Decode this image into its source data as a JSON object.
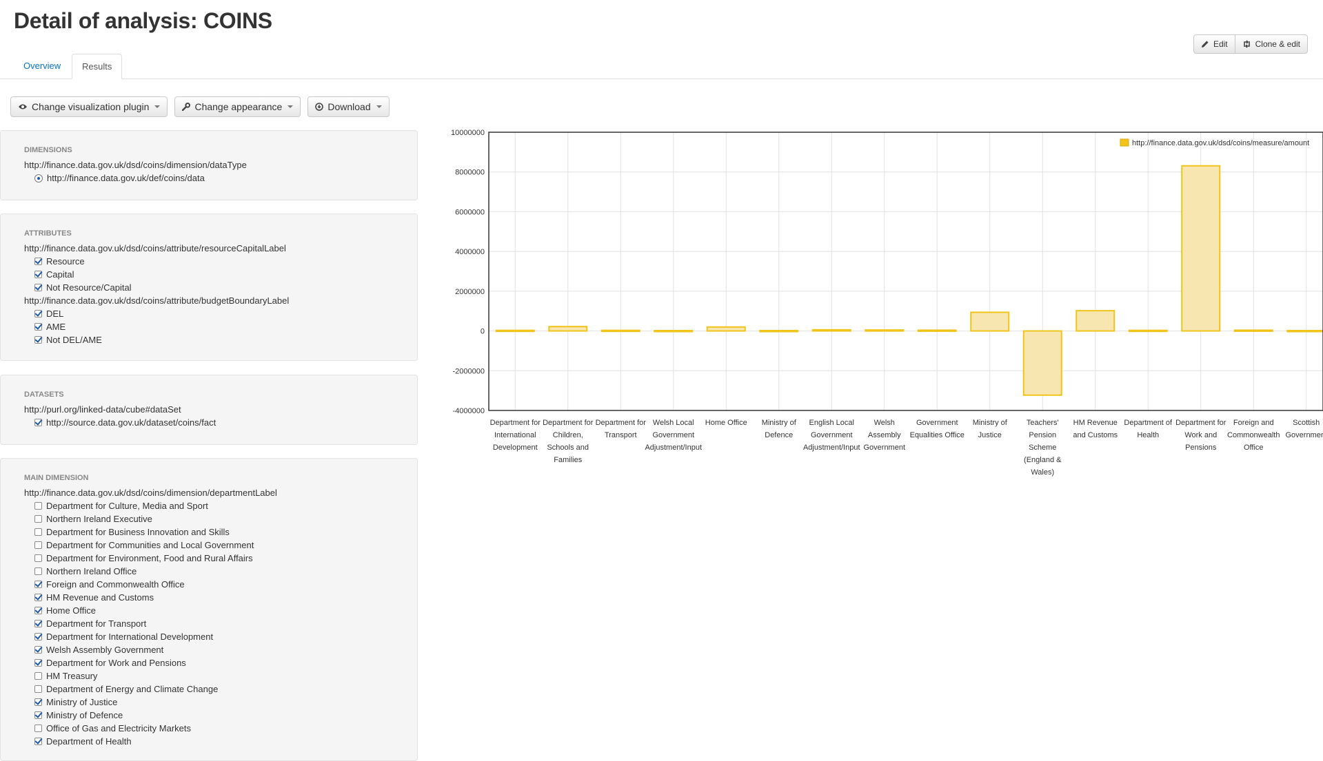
{
  "page": {
    "title": "Detail of analysis: COINS"
  },
  "actions": {
    "edit": "Edit",
    "clone": "Clone & edit"
  },
  "tabs": {
    "overview": "Overview",
    "results": "Results"
  },
  "toolbar": {
    "change_plugin": "Change visualization plugin",
    "change_appearance": "Change appearance",
    "download": "Download"
  },
  "dimensions": {
    "heading": "DIMENSIONS",
    "property": "http://finance.data.gov.uk/dsd/coins/dimension/dataType",
    "options": [
      {
        "label": "http://finance.data.gov.uk/def/coins/data",
        "selected": true
      }
    ]
  },
  "attributes": {
    "heading": "ATTRIBUTES",
    "groups": [
      {
        "property": "http://finance.data.gov.uk/dsd/coins/attribute/resourceCapitalLabel",
        "options": [
          {
            "label": "Resource",
            "checked": true
          },
          {
            "label": "Capital",
            "checked": true
          },
          {
            "label": "Not Resource/Capital",
            "checked": true
          }
        ]
      },
      {
        "property": "http://finance.data.gov.uk/dsd/coins/attribute/budgetBoundaryLabel",
        "options": [
          {
            "label": "DEL",
            "checked": true
          },
          {
            "label": "AME",
            "checked": true
          },
          {
            "label": "Not DEL/AME",
            "checked": true
          }
        ]
      }
    ]
  },
  "datasets": {
    "heading": "DATASETS",
    "property": "http://purl.org/linked-data/cube#dataSet",
    "options": [
      {
        "label": "http://source.data.gov.uk/dataset/coins/fact",
        "checked": true
      }
    ]
  },
  "main_dimension": {
    "heading": "MAIN DIMENSION",
    "property": "http://finance.data.gov.uk/dsd/coins/dimension/departmentLabel",
    "options": [
      {
        "label": "Department for Culture, Media and Sport",
        "checked": false
      },
      {
        "label": "Northern Ireland Executive",
        "checked": false
      },
      {
        "label": "Department for Business Innovation and Skills",
        "checked": false
      },
      {
        "label": "Department for Communities and Local Government",
        "checked": false
      },
      {
        "label": "Department for Environment, Food and Rural Affairs",
        "checked": false
      },
      {
        "label": "Northern Ireland Office",
        "checked": false
      },
      {
        "label": "Foreign and Commonwealth Office",
        "checked": true
      },
      {
        "label": "HM Revenue and Customs",
        "checked": true
      },
      {
        "label": "Home Office",
        "checked": true
      },
      {
        "label": "Department for Transport",
        "checked": true
      },
      {
        "label": "Department for International Development",
        "checked": true
      },
      {
        "label": "Welsh Assembly Government",
        "checked": true
      },
      {
        "label": "Department for Work and Pensions",
        "checked": true
      },
      {
        "label": "HM Treasury",
        "checked": false
      },
      {
        "label": "Department of Energy and Climate Change",
        "checked": false
      },
      {
        "label": "Ministry of Justice",
        "checked": true
      },
      {
        "label": "Ministry of Defence",
        "checked": true
      },
      {
        "label": "Office of Gas and Electricity Markets",
        "checked": false
      },
      {
        "label": "Department of Health",
        "checked": true
      }
    ]
  },
  "chart_data": {
    "type": "bar",
    "legend": "top-right",
    "grid": true,
    "ylim": [
      -4000000,
      10000000
    ],
    "yticks": [
      "10000000",
      "8000000",
      "6000000",
      "4000000",
      "2000000",
      "0",
      "-2000000",
      "-4000000"
    ],
    "series": [
      {
        "name": "http://finance.data.gov.uk/dsd/coins/measure/amount",
        "color": "#f0c419",
        "fill": "#f8e6b0"
      }
    ],
    "categories": [
      [
        "Department for",
        "International",
        "Development"
      ],
      [
        "Department for",
        "Children,",
        "Schools and",
        "Families"
      ],
      [
        "Department for",
        "Transport"
      ],
      [
        "Welsh Local",
        "Government",
        "Adjustment/Input"
      ],
      [
        "Home Office"
      ],
      [
        "Ministry of",
        "Defence"
      ],
      [
        "English Local",
        "Government",
        "Adjustment/Input"
      ],
      [
        "Welsh",
        "Assembly",
        "Government"
      ],
      [
        "Government",
        "Equalities Office"
      ],
      [
        "Ministry of",
        "Justice"
      ],
      [
        "Teachers'",
        "Pension",
        "Scheme",
        "(England &",
        "Wales)"
      ],
      [
        "HM Revenue",
        "and Customs"
      ],
      [
        "Department of",
        "Health"
      ],
      [
        "Department for",
        "Work and",
        "Pensions"
      ],
      [
        "Foreign and",
        "Commonwealth",
        "Office"
      ],
      [
        "Scottish",
        "Government"
      ]
    ],
    "values": [
      30000,
      220000,
      30000,
      20000,
      200000,
      20000,
      60000,
      50000,
      40000,
      940000,
      -3230000,
      1020000,
      30000,
      8310000,
      40000,
      20000
    ]
  }
}
